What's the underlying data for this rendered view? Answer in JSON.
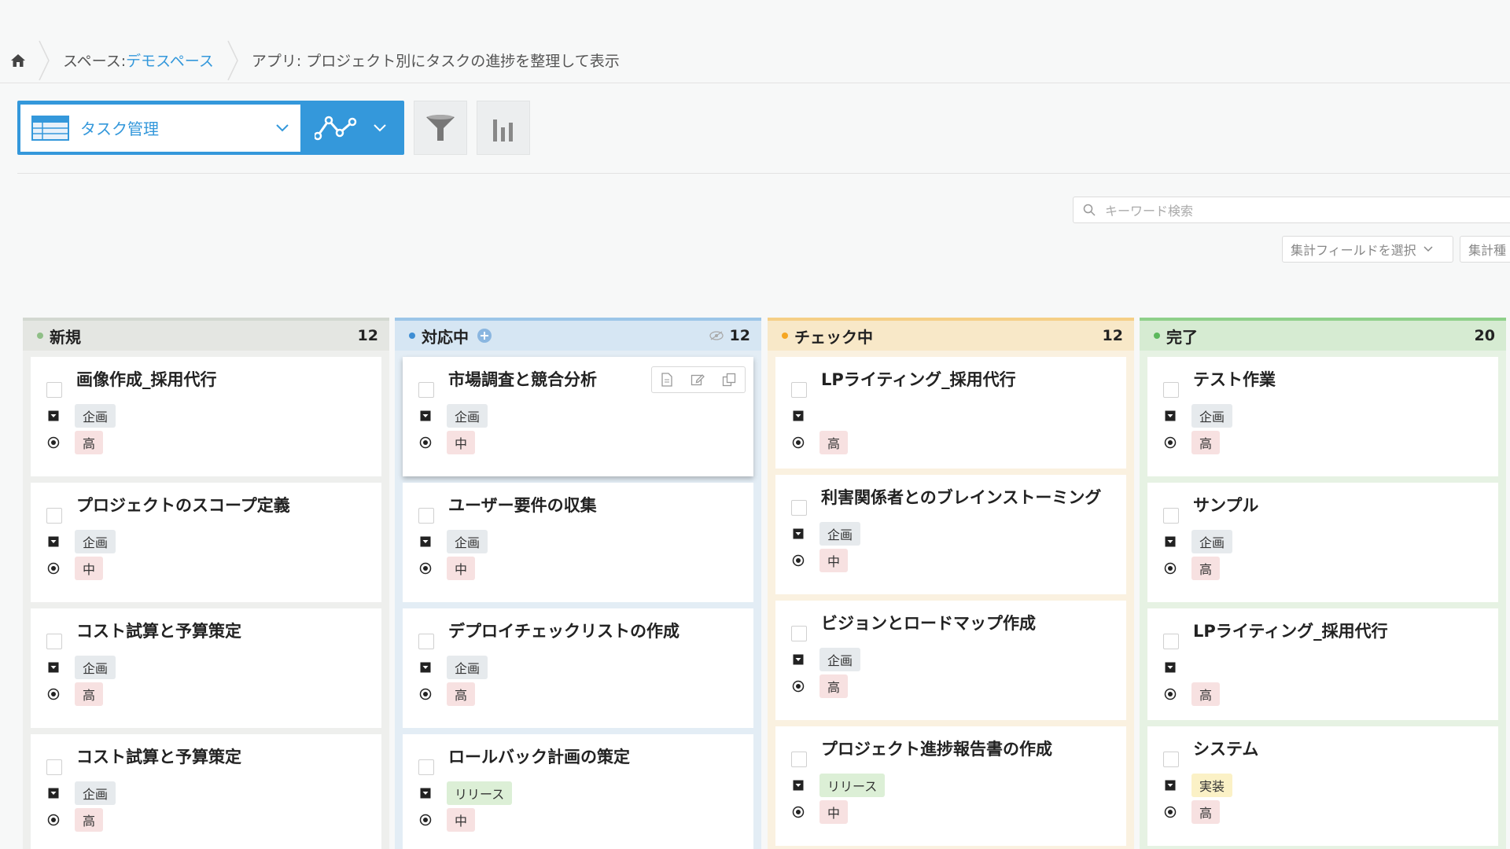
{
  "breadcrumb": {
    "space_prefix": "スペース: ",
    "space_name": "デモスペース",
    "app_label": "アプリ: プロジェクト別にタスクの進捗を整理して表示"
  },
  "toolbar": {
    "view_name": "タスク管理"
  },
  "search": {
    "placeholder": "キーワード検索"
  },
  "aggregation": {
    "field_label": "集計フィールドを選択",
    "type_label": "集計種"
  },
  "colors": {
    "accent": "#3498db",
    "new": "#a3b8a0",
    "inprogress": "#3e8ed4",
    "check": "#f5a623",
    "done": "#5cb85c"
  },
  "columns": [
    {
      "title": "新規",
      "count": "12",
      "cards": [
        {
          "title": "画像作成_採用代行",
          "category": "企画",
          "priority": "高"
        },
        {
          "title": "プロジェクトのスコープ定義",
          "category": "企画",
          "priority": "中"
        },
        {
          "title": "コスト試算と予算策定",
          "category": "企画",
          "priority": "高"
        },
        {
          "title": "コスト試算と予算策定",
          "category": "企画",
          "priority": "高"
        }
      ]
    },
    {
      "title": "対応中",
      "count": "12",
      "cards": [
        {
          "title": "市場調査と競合分析",
          "category": "企画",
          "priority": "中"
        },
        {
          "title": "ユーザー要件の収集",
          "category": "企画",
          "priority": "中"
        },
        {
          "title": "デプロイチェックリストの作成",
          "category": "企画",
          "priority": "高"
        },
        {
          "title": "ロールバック計画の策定",
          "category": "リリース",
          "priority": "中"
        }
      ]
    },
    {
      "title": "チェック中",
      "count": "12",
      "cards": [
        {
          "title": "LPライティング_採用代行",
          "category": "",
          "priority": "高"
        },
        {
          "title": "利害関係者とのブレインストーミング",
          "category": "企画",
          "priority": "中"
        },
        {
          "title": "ビジョンとロードマップ作成",
          "category": "企画",
          "priority": "高"
        },
        {
          "title": "プロジェクト進捗報告書の作成",
          "category": "リリース",
          "priority": "中"
        }
      ]
    },
    {
      "title": "完了",
      "count": "20",
      "cards": [
        {
          "title": "テスト作業",
          "category": "企画",
          "priority": "高"
        },
        {
          "title": "サンプル",
          "category": "企画",
          "priority": "高"
        },
        {
          "title": "LPライティング_採用代行",
          "category": "",
          "priority": "高"
        },
        {
          "title": "システム",
          "category": "実装",
          "priority": "高"
        }
      ]
    }
  ]
}
